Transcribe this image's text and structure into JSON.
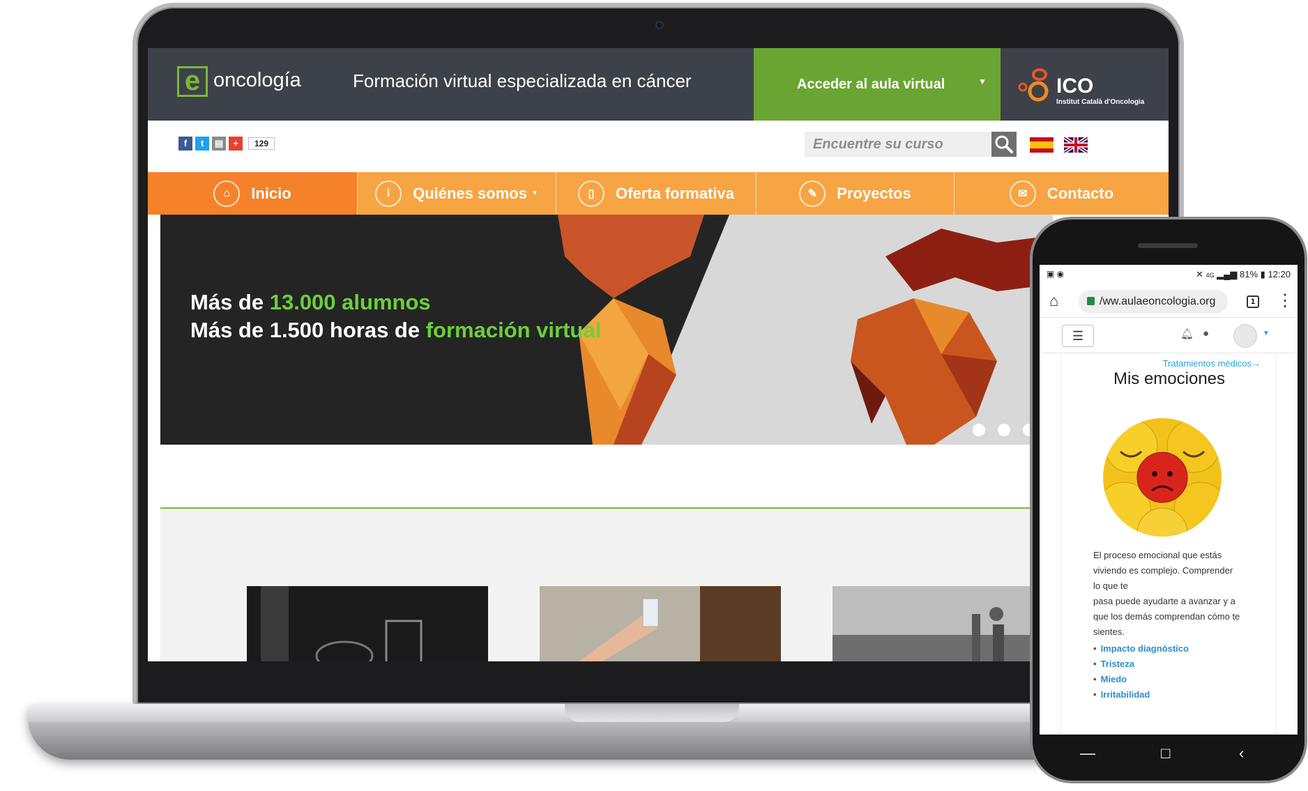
{
  "laptop": {
    "header": {
      "logo_letter": "e",
      "logo_text": "oncología",
      "tagline": "Formación virtual especializada en cáncer",
      "aula_button": "Acceder al aula virtual",
      "ico_name": "ICO",
      "ico_sub": "Institut Català d'Oncologia"
    },
    "share": {
      "count": "129"
    },
    "search": {
      "placeholder": "Encuentre su curso"
    },
    "nav": [
      {
        "label": "Inicio",
        "icon": "home-icon"
      },
      {
        "label": "Quiénes somos",
        "icon": "info-icon"
      },
      {
        "label": "Oferta formativa",
        "icon": "book-icon"
      },
      {
        "label": "Proyectos",
        "icon": "pencil-icon"
      },
      {
        "label": "Contacto",
        "icon": "mail-icon"
      }
    ],
    "hero": {
      "line1_a": "Más de ",
      "line1_b": "13.000 alumnos",
      "line2_a": "Más de 1.500 horas de ",
      "line2_b": "formación virtual"
    }
  },
  "phone": {
    "status": {
      "battery": "81%",
      "time": "12:20",
      "network": "4G"
    },
    "url": "/ww.aulaeoncologia.org",
    "tab_count": "1",
    "breadcrumb": "Tratamientos médicos→",
    "title": "Mis emociones",
    "text": [
      "El proceso emocional que estás",
      "viviendo es complejo. Comprender",
      "lo que te",
      "pasa puede ayudarte a avanzar y a",
      "que los demás comprendan cómo te",
      "sientes."
    ],
    "links": [
      "Impacto diagnóstico",
      "Tristeza",
      "Miedo",
      "Irritabilidad"
    ]
  },
  "colors": {
    "header_bg": "#3d4149",
    "green": "#6aa533",
    "nav_orange": "#f7a443",
    "nav_active": "#f5822b",
    "hero_green": "#6bd03b",
    "link_blue": "#2a8fd0"
  }
}
